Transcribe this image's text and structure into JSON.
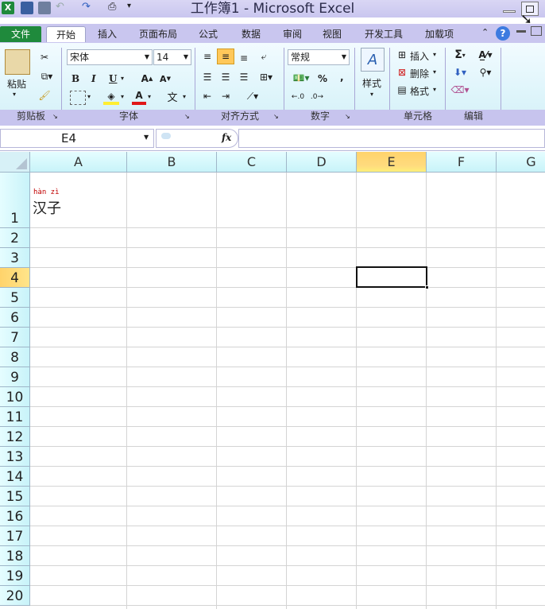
{
  "window": {
    "title": "工作簿1 - Microsoft Excel"
  },
  "tabs": [
    "文件",
    "开始",
    "插入",
    "页面布局",
    "公式",
    "数据",
    "审阅",
    "视图",
    "开发工具",
    "加载项"
  ],
  "ribbon": {
    "clipboard": {
      "label": "剪贴板",
      "paste": "粘贴"
    },
    "font": {
      "label": "字体",
      "font_name": "宋体",
      "font_size": "14",
      "bold": "B",
      "italic": "I",
      "underline": "U"
    },
    "alignment": {
      "label": "对齐方式"
    },
    "number": {
      "label": "数字",
      "format": "常规",
      "percent": "%",
      "comma": ","
    },
    "styles": {
      "label": "样式"
    },
    "cells": {
      "label": "单元格",
      "insert": "插入",
      "delete": "删除",
      "format": "格式"
    },
    "editing": {
      "label": "编辑"
    }
  },
  "formula_bar": {
    "name_box": "E4",
    "fx": "fx",
    "content": ""
  },
  "sheet": {
    "columns": [
      "A",
      "B",
      "C",
      "D",
      "E",
      "F",
      "G"
    ],
    "rows": [
      "1",
      "2",
      "3",
      "4",
      "5",
      "6",
      "7",
      "8",
      "9",
      "10",
      "11",
      "12",
      "13",
      "14",
      "15",
      "16",
      "17",
      "18",
      "19",
      "20"
    ],
    "active_cell": "E4",
    "cells": {
      "A1_ruby": "hàn zì",
      "A1_text": "汉子"
    }
  },
  "colors": {
    "file_tab": "#1f8a3c",
    "selected_header": "#ffd36b",
    "header_bg": "#c8f3f9"
  }
}
